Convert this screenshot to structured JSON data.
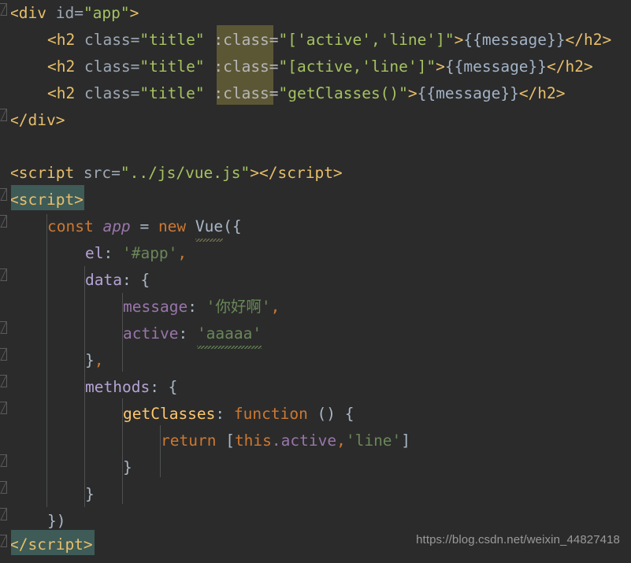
{
  "editor": {
    "theme_name": "darcula",
    "background": "#2b2b2b",
    "language": "html",
    "watermark": "https://blog.csdn.net/weixin_44827418"
  },
  "colors": {
    "background": "#2b2b2b",
    "tag": "#e8bf6a",
    "attribute": "#9da8b4",
    "attribute_highlighted": "#b6b6b6",
    "html_string": "#a5c261",
    "mustache": "#a3b3c6",
    "keyword": "#cc7832",
    "variable_italic": "#9876aa",
    "object_key": "#b5a3d6",
    "property": "#9876aa",
    "function_name": "#ffc66d",
    "js_string": "#6a8759",
    "punctuation": "#a9b7c6",
    "search_highlight_olive": "#5b5735",
    "selection_highlight_teal": "#3e5b57",
    "indent_guide": "#4f5050",
    "fold_marker": "#5c5c5c",
    "watermark_text": "#9a9a9a"
  },
  "code": {
    "line01": {
      "tag_open": "<div",
      "attr_id": " id=",
      "attr_id_value": "\"app\"",
      "tag_close": ">"
    },
    "line02": {
      "tag_open": "<h2",
      "attr_class": " class=",
      "attr_class_value": "\"title\"",
      "space": " ",
      "attr_bind": ":class=",
      "attr_bind_value": "\"['active','line']\"",
      "gt": ">",
      "mustache": "{{message}}",
      "tag_end": "</h2>"
    },
    "line03": {
      "tag_open": "<h2",
      "attr_class": " class=",
      "attr_class_value": "\"title\"",
      "space": " ",
      "attr_bind": ":class=",
      "attr_bind_value": "\"[active,'line']\"",
      "gt": ">",
      "mustache": "{{message}}",
      "tag_end": "</h2>"
    },
    "line04": {
      "tag_open": "<h2",
      "attr_class": " class=",
      "attr_class_value": "\"title\"",
      "space": " ",
      "attr_bind": ":class=",
      "attr_bind_value": "\"getClasses()\"",
      "gt": ">",
      "mustache": "{{message}}",
      "tag_end": "</h2>"
    },
    "line05": {
      "tag": "</div>"
    },
    "line07": {
      "tag_open": "<script",
      "attr_src": " src=",
      "attr_src_value": "\"../js/vue.js\"",
      "gt": ">",
      "tag_end": "</script>"
    },
    "line08": {
      "tag": "<script>"
    },
    "line09": {
      "kw_const": "const",
      "var_app": "app",
      "eq": "=",
      "kw_new": "new",
      "cls_vue": "Vue",
      "open": "({"
    },
    "line10": {
      "key": "el",
      "colon": ": ",
      "value": "'#app'",
      "comma": ","
    },
    "line11": {
      "key": "data",
      "colon": ": ",
      "brace": "{"
    },
    "line12": {
      "key": "message",
      "colon": ": ",
      "value": "'你好啊'",
      "comma": ","
    },
    "line13": {
      "key": "active",
      "colon": ": ",
      "value": "'aaaaa'"
    },
    "line14": {
      "brace": "}",
      "comma": ","
    },
    "line15": {
      "key": "methods",
      "colon": ": ",
      "brace": "{"
    },
    "line16": {
      "fn_name": "getClasses",
      "colon": ": ",
      "kw_function": "function",
      "parens": " () ",
      "brace": "{"
    },
    "line17": {
      "kw_return": "return",
      "bracket_open": " [",
      "kw_this": "this",
      "dot_prop": ".active",
      "comma": ",",
      "string": "'line'",
      "bracket_close": "]"
    },
    "line18": {
      "brace": "}"
    },
    "line19": {
      "brace": "}"
    },
    "line20": {
      "close": "})"
    },
    "line21": {
      "tag": "</script>"
    }
  }
}
